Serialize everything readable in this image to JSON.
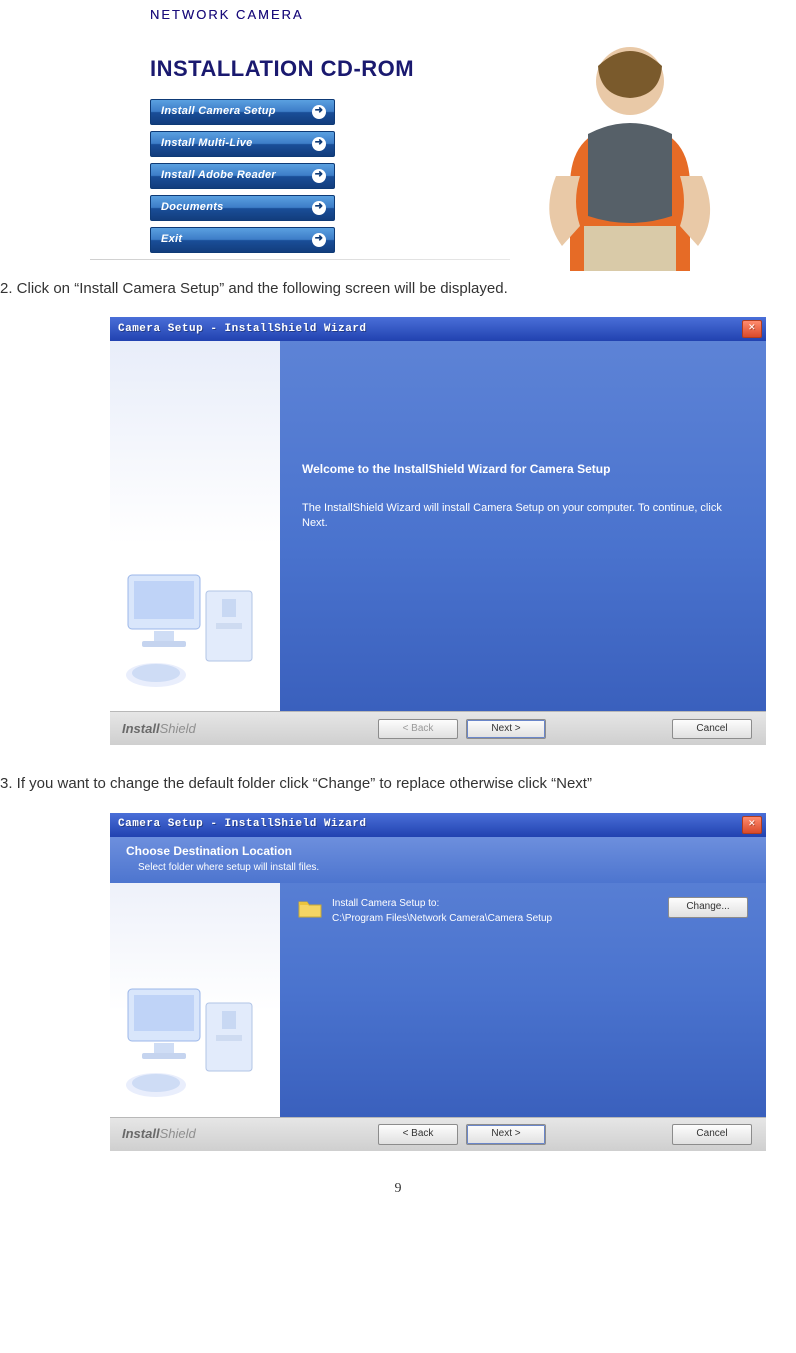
{
  "cdrom": {
    "product": "NETWORK CAMERA",
    "title": "INSTALLATION CD-ROM",
    "buttons": [
      "Install Camera Setup",
      "Install Multi-Live",
      "Install Adobe Reader",
      "Documents",
      "Exit"
    ]
  },
  "step2": {
    "instruction": "2. Click on “Install Camera Setup” and the following screen will be displayed.",
    "title": "Camera Setup - InstallShield Wizard",
    "welcome": "Welcome to the InstallShield Wizard for Camera Setup",
    "desc": "The InstallShield Wizard will install Camera Setup on your computer.  To continue, click Next.",
    "footer_brand_strong": "Install",
    "footer_brand_light": "Shield",
    "back": "< Back",
    "next": "Next >",
    "cancel": "Cancel"
  },
  "step3": {
    "instruction": "3. If you want to change the default folder click “Change” to replace otherwise click “Next”",
    "title": "Camera Setup - InstallShield Wizard",
    "dest_title": "Choose Destination Location",
    "dest_sub": "Select folder where setup will install files.",
    "install_to": "Install Camera Setup to:",
    "path": "C:\\Program Files\\Network Camera\\Camera Setup",
    "change": "Change...",
    "footer_brand_strong": "Install",
    "footer_brand_light": "Shield",
    "back": "< Back",
    "next": "Next >",
    "cancel": "Cancel"
  },
  "page_number": "9"
}
